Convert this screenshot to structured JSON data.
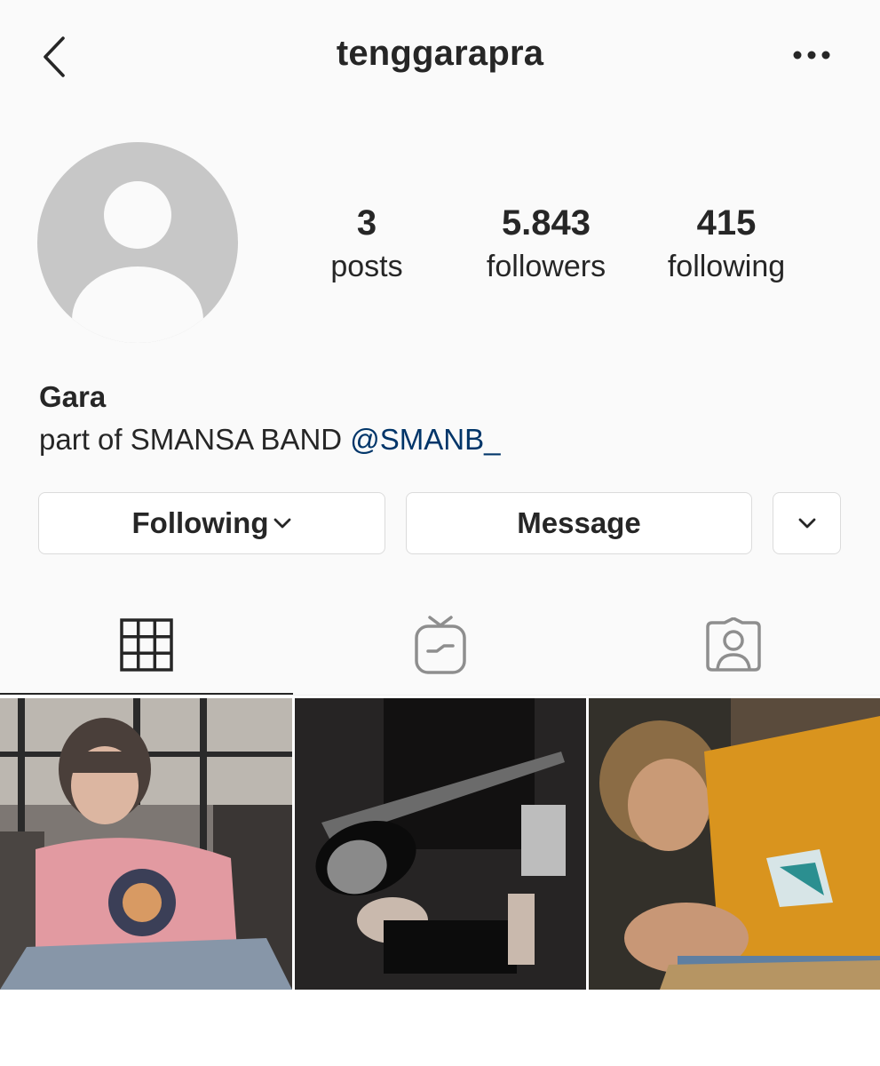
{
  "header": {
    "username": "tenggarapra",
    "back_icon": "chevron-left-icon",
    "more_icon": "more-horizontal-icon"
  },
  "profile": {
    "avatar_icon": "default-avatar-icon",
    "stats": {
      "posts": {
        "count": "3",
        "label": "posts"
      },
      "followers": {
        "count": "5.843",
        "label": "followers"
      },
      "following": {
        "count": "415",
        "label": "following"
      }
    },
    "display_name": "Gara",
    "bio_text": "part of SMANSA BAND ",
    "bio_mention": "@SMANB_"
  },
  "actions": {
    "following_label": "Following",
    "message_label": "Message",
    "suggest_icon": "chevron-down-icon"
  },
  "tabs": [
    {
      "name": "posts-grid",
      "icon": "grid-icon",
      "active": true
    },
    {
      "name": "igtv",
      "icon": "igtv-icon",
      "active": false
    },
    {
      "name": "tagged",
      "icon": "tagged-person-icon",
      "active": false
    }
  ],
  "posts": [
    {
      "description": "photo"
    },
    {
      "description": "photo"
    },
    {
      "description": "photo"
    }
  ],
  "colors": {
    "background": "#fafafa",
    "text": "#262626",
    "mention": "#003569",
    "border": "#dbdbdb",
    "avatar": "#c7c7c7",
    "icon_inactive": "#8e8e8e"
  }
}
